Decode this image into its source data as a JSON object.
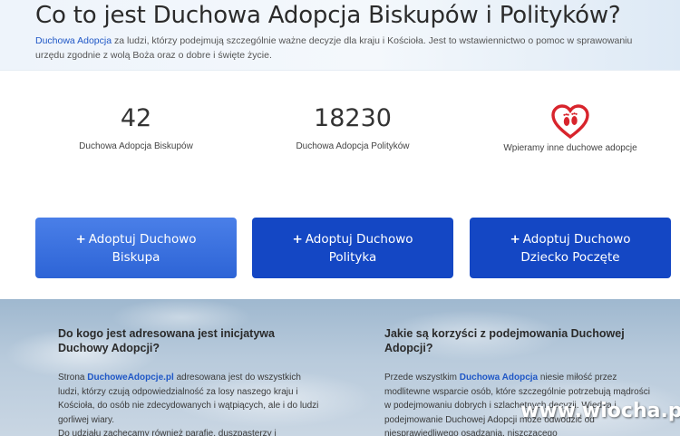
{
  "hero": {
    "title": "Co to jest Duchowa Adopcja Biskupów i Polityków?",
    "intro_link": "Duchowa Adopcja",
    "intro_text": " za ludzi, którzy podejmują szczególnie ważne decyzje dla kraju i Kościoła. Jest to wstawiennictwo o pomoc w sprawowaniu urzędu zgodnie z wolą Boża oraz o dobre i święte życie."
  },
  "stats": [
    {
      "value": "42",
      "label": "Duchowa Adopcja Biskupów"
    },
    {
      "value": "18230",
      "label": "Duchowa Adopcja Polityków"
    },
    {
      "icon": "heart-footprints-icon",
      "label": "Wpieramy inne duchowe adopcje"
    }
  ],
  "buttons": [
    {
      "plus": "+",
      "line1": "Adoptuj Duchowo",
      "line2": "Biskupa"
    },
    {
      "plus": "+",
      "line1": "Adoptuj Duchowo",
      "line2": "Polityka"
    },
    {
      "plus": "+",
      "line1": "Adoptuj Duchowo",
      "line2": "Dziecko Poczęte"
    }
  ],
  "sections": [
    {
      "heading": "Do kogo jest adresowana jest inicjatywa Duchowy Adopcji?",
      "text_before": "Strona ",
      "link": "DuchoweAdopcje.pl",
      "text_after": " adresowana jest do wszystkich ludzi, którzy czują odpowiedzialność za losy naszego kraju i Kościoła, do osób nie zdecydowanych i wątpiących, ale i do ludzi gorliwej wiary.",
      "text_extra": "Do udziału zachęcamy również parafie, duszpasterzy i"
    },
    {
      "heading": "Jakie są korzyści z podejmowania Duchowej Adopcji?",
      "text_before": "Przede wszystkim ",
      "link": "Duchowa Adopcja",
      "text_after": " niesie miłość przez modlitewne wsparcie osób, które szczególnie potrzebują mądrości w podejmowaniu dobrych i szlachetnych decyzji. Wiedza i podejmowanie Duchowej Adopcji może odwodzić od niesprawiedliwego osądzania, niszczącego"
    }
  ],
  "watermark": "www.wiocha.pl",
  "colors": {
    "link": "#1f57c6",
    "button": "#1447c4",
    "button_light": "#2d64d6",
    "heart": "#d8242c"
  }
}
